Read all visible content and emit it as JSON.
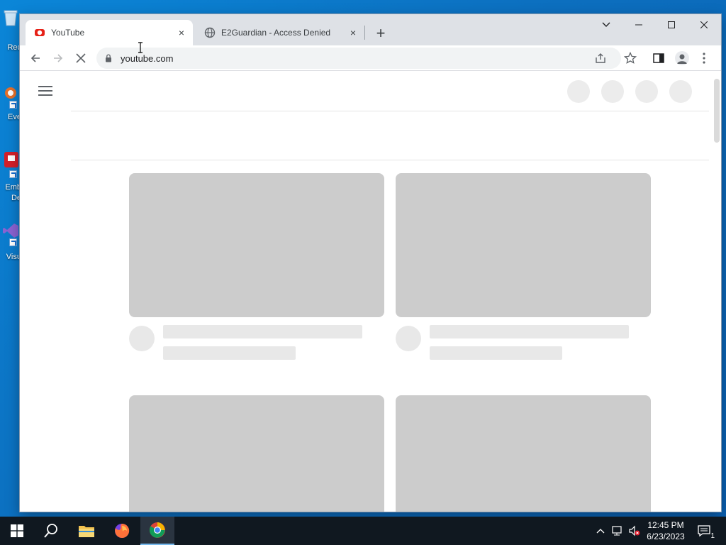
{
  "desktop": {
    "icons": [
      {
        "label": "Rec",
        "name": "recycle-bin"
      },
      {
        "label": "Eve",
        "name": "everything"
      },
      {
        "label": "Emb",
        "label2": "De",
        "name": "embarcadero"
      },
      {
        "label": "Visu",
        "name": "visual-studio"
      }
    ]
  },
  "browser": {
    "tabs": [
      {
        "title": "YouTube",
        "active": true,
        "close": "×"
      },
      {
        "title": "E2Guardian - Access Denied",
        "active": false,
        "close": "×"
      }
    ],
    "new_tab": "+",
    "address": {
      "url": "youtube.com"
    }
  },
  "taskbar": {
    "clock_time": "12:45 PM",
    "clock_date": "6/23/2023",
    "notification_count": "1"
  },
  "colors": {
    "accent": "#1a73e8",
    "skeleton": "#cccccc",
    "taskbar": "#101820",
    "desktop": "#0c6fbf"
  }
}
